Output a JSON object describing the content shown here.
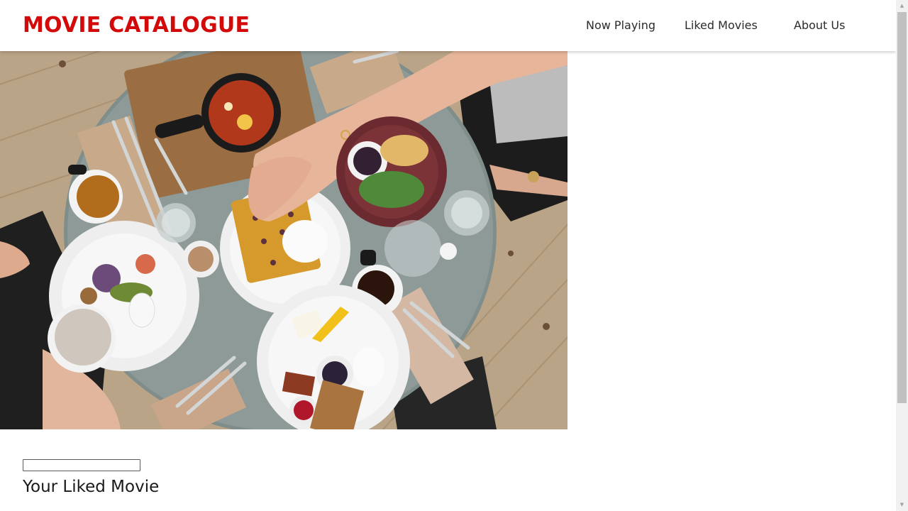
{
  "header": {
    "brand": "MOVIE CATALOGUE",
    "brand_color": "#d20a0a",
    "nav": [
      {
        "label": "Now Playing"
      },
      {
        "label": "Liked Movies"
      },
      {
        "label": "About Us"
      }
    ]
  },
  "hero": {
    "image": "overhead photo of a breakfast table with waffles, shakshuka, coffee cups and plates"
  },
  "search": {
    "value": "",
    "placeholder": ""
  },
  "main": {
    "section_title": "Your Liked Movie"
  },
  "scrollbar": {
    "icons": [
      "scroll-up-arrow",
      "scroll-down-arrow"
    ]
  }
}
